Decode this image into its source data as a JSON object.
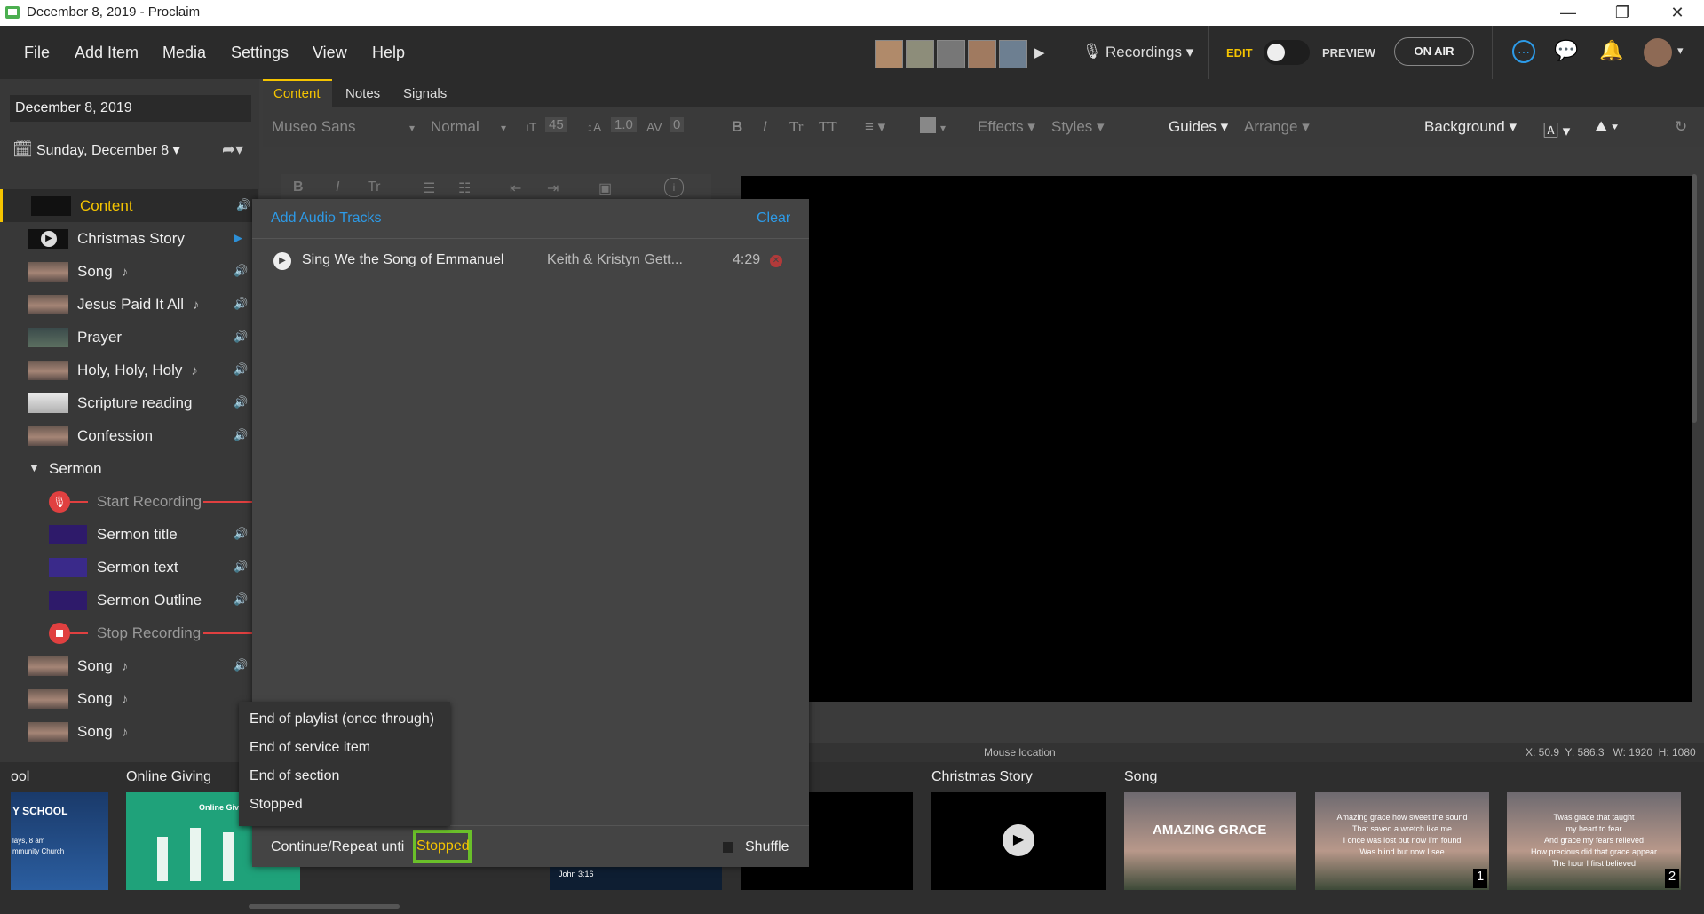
{
  "window": {
    "title": "December 8, 2019 - Proclaim",
    "controls": [
      "—",
      "❐",
      "✕"
    ]
  },
  "menu": {
    "items": [
      "File",
      "Add Item",
      "Media",
      "Settings",
      "View",
      "Help"
    ]
  },
  "header": {
    "recordings_label": "Recordings",
    "edit_label": "EDIT",
    "preview_label": "PREVIEW",
    "on_air_label": "ON AIR"
  },
  "sidebar": {
    "date_value": "December 8, 2019",
    "service_date": "Sunday, December 8",
    "items": [
      {
        "label": "Content",
        "note": ""
      },
      {
        "label": "Christmas Story",
        "note": ""
      },
      {
        "label": "Song",
        "note": "♪"
      },
      {
        "label": "Jesus Paid It All",
        "note": "♪"
      },
      {
        "label": "Prayer",
        "note": ""
      },
      {
        "label": "Holy, Holy, Holy",
        "note": "♪"
      },
      {
        "label": "Scripture reading",
        "note": ""
      },
      {
        "label": "Confession",
        "note": ""
      },
      {
        "label": "Sermon",
        "note": ""
      },
      {
        "label": "Start Recording",
        "note": ""
      },
      {
        "label": "Sermon title",
        "note": ""
      },
      {
        "label": "Sermon text",
        "note": ""
      },
      {
        "label": "Sermon Outline",
        "note": ""
      },
      {
        "label": "Stop Recording",
        "note": ""
      },
      {
        "label": "Song",
        "note": "♪"
      },
      {
        "label": "Song",
        "note": "♪"
      },
      {
        "label": "Song",
        "note": "♪"
      }
    ]
  },
  "tabs": [
    "Content",
    "Notes",
    "Signals"
  ],
  "toolbar": {
    "font": "Museo Sans",
    "weight": "Normal",
    "size": "45",
    "line_height": "1.0",
    "spacing": "0",
    "bold": "B",
    "italic": "I",
    "tr": "Tr",
    "tt": "TT",
    "effects": "Effects",
    "styles": "Styles",
    "guides": "Guides",
    "arrange": "Arrange",
    "background": "Background"
  },
  "status": {
    "mouse_location_label": "Mouse location",
    "coords": "X: 50.9  Y: 586.3   W: 1920  H: 1080"
  },
  "audio_popup": {
    "add_label": "Add Audio Tracks",
    "clear_label": "Clear",
    "track": {
      "title": "Sing We the Song of Emmanuel",
      "artist": "Keith & Kristyn Gett...",
      "duration": "4:29"
    },
    "repeat_label": "Continue/Repeat unti",
    "repeat_value": "Stopped",
    "shuffle_label": "Shuffle"
  },
  "dropdown": {
    "options": [
      "End of playlist (once through)",
      "End of service item",
      "End of section",
      "Stopped"
    ]
  },
  "strip": {
    "labels": [
      "ool",
      "Online Giving",
      "Christmas Story",
      "Song"
    ],
    "thumb_texts": {
      "school": "Y SCHOOL",
      "school_sub1": "lays, 8 am",
      "school_sub2": "mmunity Church",
      "giving": "Online Giving",
      "verse": "John 3:16",
      "amazing": "AMAZING GRACE",
      "lyrics1_a": "Amazing grace how sweet the sound",
      "lyrics1_b": "That saved a wretch like me",
      "lyrics1_c": "I once was lost but now I'm found",
      "lyrics1_d": "Was blind but now I see",
      "lyrics2_a": "Twas grace that taught",
      "lyrics2_b": "my heart to fear",
      "lyrics2_c": "And grace my fears relieved",
      "lyrics2_d": "How precious did that grace appear",
      "lyrics2_e": "The hour I first believed",
      "num1": "1",
      "num2": "2"
    }
  },
  "colors": {
    "accent_yellow": "#f5c400",
    "link_blue": "#2d9be8",
    "recording_red": "#e04040",
    "highlight_green": "#6abf2a"
  }
}
